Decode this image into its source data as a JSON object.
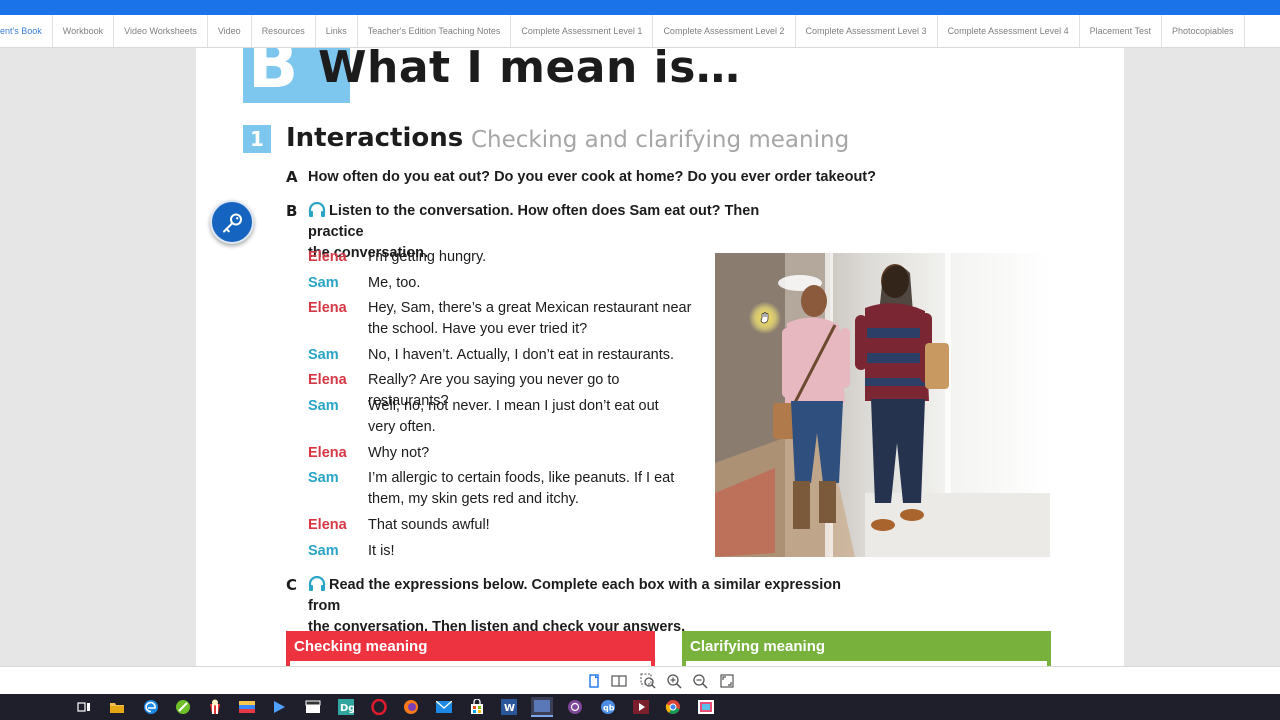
{
  "tabs": [
    {
      "label": "ent's Book",
      "active": true
    },
    {
      "label": "Workbook"
    },
    {
      "label": "Video Worksheets"
    },
    {
      "label": "Video"
    },
    {
      "label": "Resources"
    },
    {
      "label": "Links"
    },
    {
      "label": "Teacher's Edition Teaching Notes"
    },
    {
      "label": "Complete Assessment Level 1"
    },
    {
      "label": "Complete Assessment Level 2"
    },
    {
      "label": "Complete Assessment Level 3"
    },
    {
      "label": "Complete Assessment Level 4"
    },
    {
      "label": "Placement Test"
    },
    {
      "label": "Photocopiables"
    }
  ],
  "unit": {
    "letter": "B",
    "title": "What I mean is…"
  },
  "section": {
    "number": "1",
    "title": "Interactions",
    "subtitle": "Checking and clarifying meaning"
  },
  "questions": {
    "a": {
      "letter": "A",
      "text": "How often do you eat out? Do you ever cook at home? Do you ever order takeout?"
    },
    "b": {
      "letter": "B",
      "text1": "Listen to the conversation. How often does Sam eat out? Then practice",
      "text2": "the conversation."
    },
    "c": {
      "letter": "C",
      "text1": "Read the expressions below. Complete each box with a similar expression from",
      "text2": "the conversation. Then listen and check your answers."
    }
  },
  "conversation": [
    {
      "speaker": "Elena",
      "lines": [
        "I’m getting hungry."
      ]
    },
    {
      "speaker": "Sam",
      "lines": [
        "Me, too."
      ]
    },
    {
      "speaker": "Elena",
      "lines": [
        "Hey, Sam, there’s a great Mexican restaurant near",
        "the school. Have you ever tried it?"
      ]
    },
    {
      "speaker": "Sam",
      "lines": [
        "No, I haven’t. Actually, I don’t eat in restaurants."
      ]
    },
    {
      "speaker": "Elena",
      "lines": [
        "Really? Are you saying you never go to restaurants?"
      ]
    },
    {
      "speaker": "Sam",
      "lines": [
        "Well, no, not never. I mean I just don’t eat out",
        "very often."
      ]
    },
    {
      "speaker": "Elena",
      "lines": [
        "Why not?"
      ]
    },
    {
      "speaker": "Sam",
      "lines": [
        "I’m allergic to certain foods, like peanuts. If I eat",
        "them, my skin gets red and itchy."
      ]
    },
    {
      "speaker": "Elena",
      "lines": [
        "That sounds awful!"
      ]
    },
    {
      "speaker": "Sam",
      "lines": [
        "It is!"
      ]
    }
  ],
  "boxes": {
    "checking": "Checking meaning",
    "clarifying": "Clarifying meaning"
  },
  "colors": {
    "accent_blue": "#7dc7ee",
    "elena": "#d63945",
    "sam": "#2aa5c6",
    "checking": "#ee3340",
    "clarifying": "#78b23d",
    "topbar": "#1a73e8"
  },
  "icons": {
    "key_button": "key-icon",
    "viewer_toolbar": [
      "single-page-icon",
      "two-page-icon",
      "zoom-area-icon",
      "zoom-in-icon",
      "zoom-out-icon",
      "fit-screen-icon"
    ],
    "taskbar": [
      "task-view-icon",
      "file-explorer-icon",
      "edge-icon",
      "app-green-icon",
      "popcorn-icon",
      "stripes-icon",
      "play-icon",
      "clapper-icon",
      "dictionary-icon",
      "opera-icon",
      "firefox-icon",
      "mail-icon",
      "store-icon",
      "word-icon",
      "app-active-icon",
      "tor-icon",
      "qbittorrent-icon",
      "video-player-icon",
      "chrome-icon",
      "image-app-icon"
    ]
  }
}
